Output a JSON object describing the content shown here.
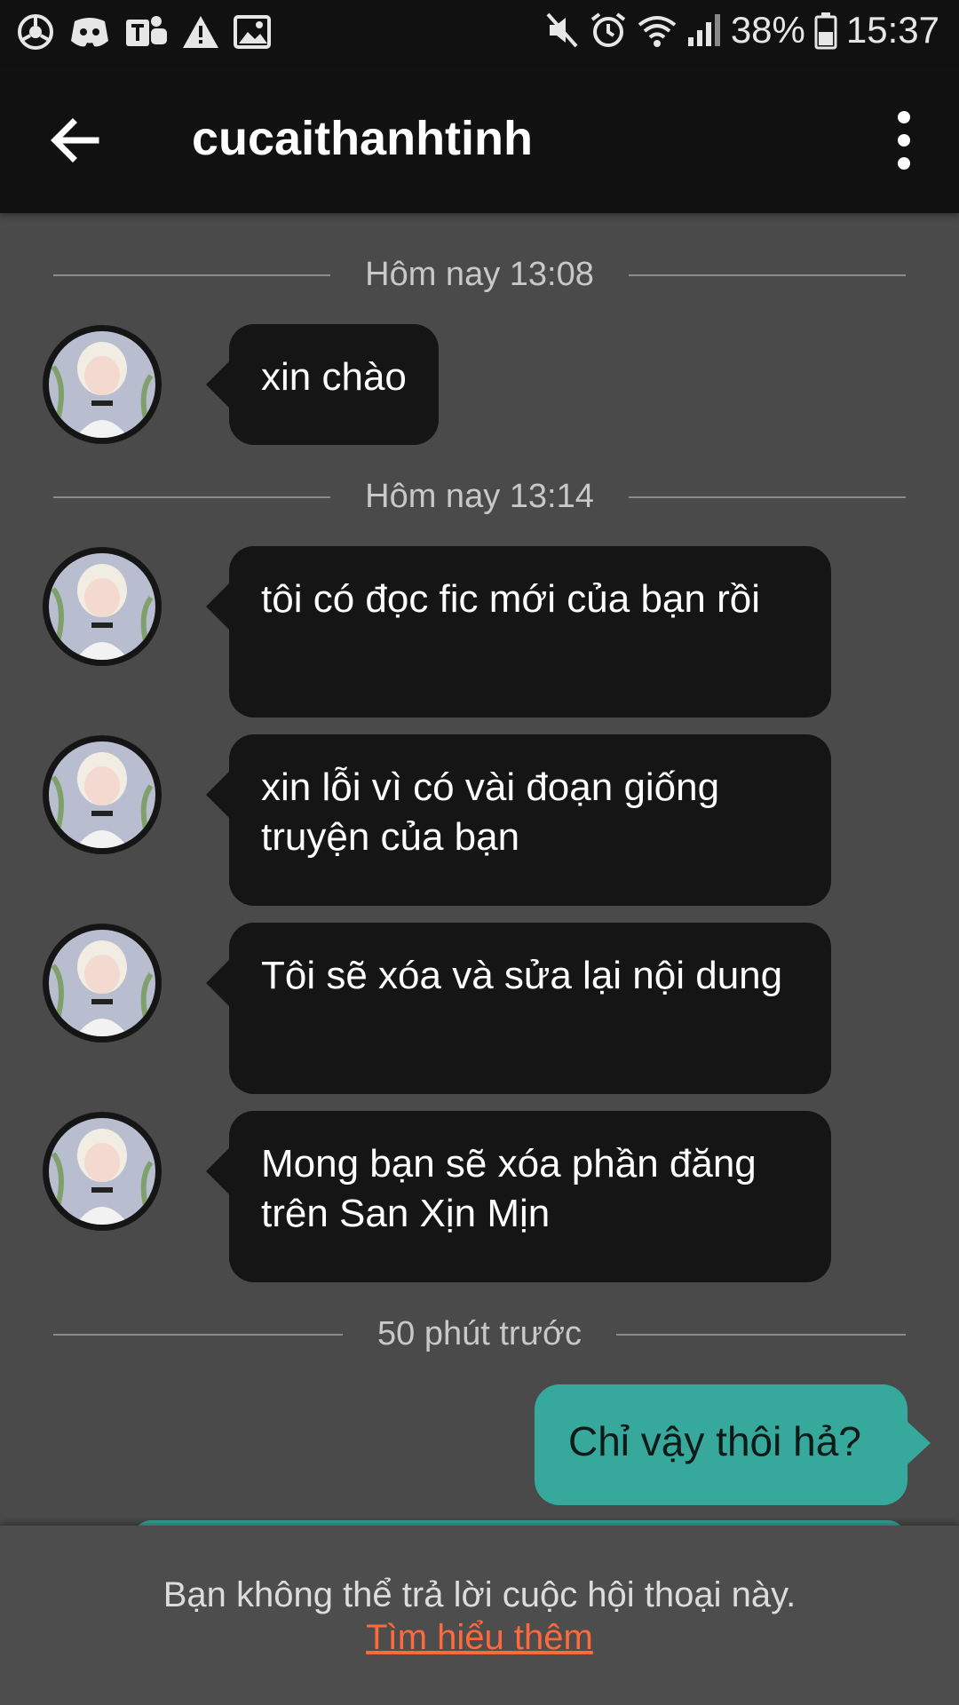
{
  "status_bar": {
    "left_icons": [
      "chrome-like-icon",
      "discord-icon",
      "teams-icon",
      "warning-icon",
      "gallery-icon"
    ],
    "right_icons": [
      "mute-icon",
      "alarm-icon",
      "wifi-icon",
      "signal-icon",
      "battery-icon"
    ],
    "battery": "38%",
    "time": "15:37"
  },
  "header": {
    "title": "cucaithanhtinh",
    "back_icon": "arrow-left-icon",
    "menu_icon": "more-vertical-icon"
  },
  "dividers": [
    {
      "label": "Hôm nay 13:08"
    },
    {
      "label": "Hôm nay 13:14"
    },
    {
      "label": "50 phút trước"
    }
  ],
  "messages_in": [
    {
      "text": "xin chào"
    },
    {
      "text": "tôi có đọc fic mới của bạn rồi"
    },
    {
      "text": "xin lỗi vì có vài đoạn giống truyện của bạn"
    },
    {
      "text": "Tôi sẽ xóa và sửa lại nội dung"
    },
    {
      "text": "Mong bạn sẽ xóa phần đăng trên San Xịn Mịn"
    }
  ],
  "messages_out": [
    {
      "text": "Chỉ vậy thôi hả?"
    }
  ],
  "footer": {
    "notice": "Bạn không thể trả lời cuộc hội thoại này.",
    "link": "Tìm hiểu thêm"
  },
  "colors": {
    "background": "#4a4a4a",
    "bar": "#111111",
    "bubble_in": "#151515",
    "bubble_out": "#36a89c",
    "link": "#ff6a3d"
  }
}
